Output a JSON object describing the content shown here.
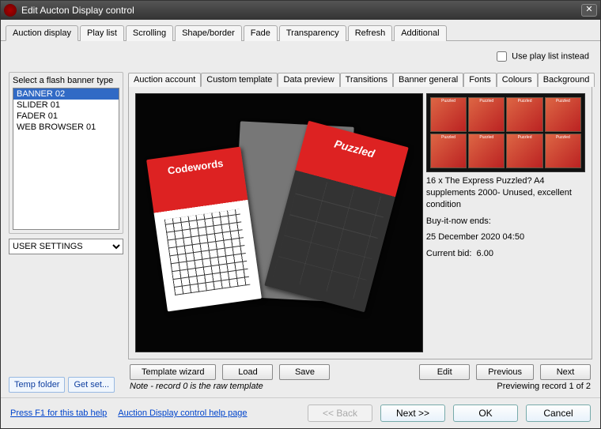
{
  "window": {
    "title": "Edit Aucton Display control"
  },
  "outer_tabs": [
    "Auction display",
    "Play list",
    "Scrolling",
    "Shape/border",
    "Fade",
    "Transparency",
    "Refresh",
    "Additional"
  ],
  "outer_active": 0,
  "checkbox": {
    "label": "Use play list instead",
    "checked": false
  },
  "left": {
    "label": "Select a flash banner type",
    "items": [
      "BANNER 02",
      "SLIDER 01",
      "FADER 01",
      "WEB BROWSER 01"
    ],
    "selected": 0,
    "dropdown": "USER SETTINGS",
    "buttons": {
      "temp": "Temp folder",
      "getset": "Get set..."
    }
  },
  "inner_tabs": [
    "Auction account",
    "Custom template",
    "Data preview",
    "Transitions",
    "Banner general",
    "Fonts",
    "Colours",
    "Background"
  ],
  "inner_active": 1,
  "preview": {
    "thumb_label": "Puzzled",
    "desc_line1": "16 x The Express Puzzled? A4 supplements 2000- Unused, excellent condition",
    "buynow_label": "Buy-it-now ends:",
    "buynow_value": "25 December 2020 04:50",
    "currentbid_label": "Current bid:",
    "currentbid_value": "6.00"
  },
  "toolbar": {
    "wizard": "Template wizard",
    "load": "Load",
    "save": "Save",
    "edit": "Edit",
    "previous": "Previous",
    "next": "Next"
  },
  "note": {
    "left": "Note - record 0 is the raw template",
    "right": "Previewing record 1 of 2"
  },
  "footer": {
    "help1": "Press F1 for this tab help",
    "help2": "Auction Display control help page",
    "back": "<< Back",
    "next": "Next >>",
    "ok": "OK",
    "cancel": "Cancel"
  }
}
